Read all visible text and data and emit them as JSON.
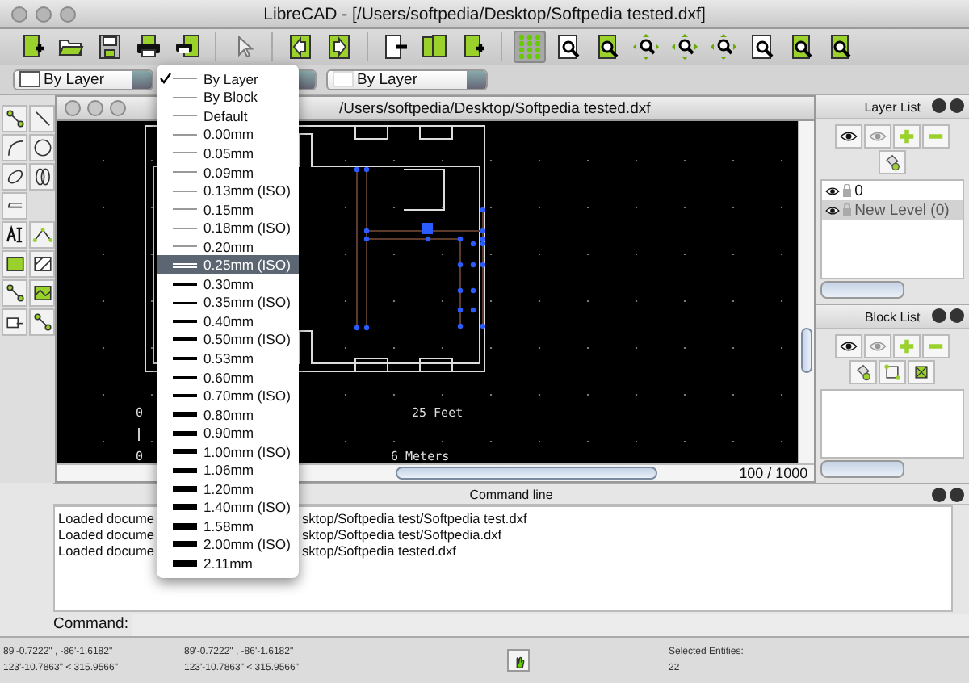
{
  "window": {
    "title": "LibreCAD - [/Users/softpedia/Desktop/Softpedia tested.dxf]"
  },
  "toolbar": {
    "grid_toggle": {
      "on": true
    }
  },
  "pen_toolbar": {
    "color_combo": "By Layer",
    "line_type_combo": "By Layer"
  },
  "line_width_menu": {
    "items": [
      {
        "label": "By Layer",
        "checked": true,
        "selected": false,
        "kind": "hair"
      },
      {
        "label": "By Block",
        "checked": false,
        "selected": false,
        "kind": "hair"
      },
      {
        "label": "Default",
        "checked": false,
        "selected": false,
        "kind": "hair"
      },
      {
        "label": "0.00mm",
        "checked": false,
        "selected": false,
        "kind": "hair"
      },
      {
        "label": "0.05mm",
        "checked": false,
        "selected": false,
        "kind": "hair"
      },
      {
        "label": "0.09mm",
        "checked": false,
        "selected": false,
        "kind": "hair"
      },
      {
        "label": "0.13mm (ISO)",
        "checked": false,
        "selected": false,
        "kind": "hair"
      },
      {
        "label": "0.15mm",
        "checked": false,
        "selected": false,
        "kind": "hair"
      },
      {
        "label": "0.18mm (ISO)",
        "checked": false,
        "selected": false,
        "kind": "hair"
      },
      {
        "label": "0.20mm",
        "checked": false,
        "selected": false,
        "kind": "hair"
      },
      {
        "label": "0.25mm (ISO)",
        "checked": false,
        "selected": true,
        "kind": "double"
      },
      {
        "label": "0.30mm",
        "checked": false,
        "selected": false,
        "kind": "thin"
      },
      {
        "label": "0.35mm (ISO)",
        "checked": false,
        "selected": false,
        "kind": "thin"
      },
      {
        "label": "0.40mm",
        "checked": false,
        "selected": false,
        "kind": "thin"
      },
      {
        "label": "0.50mm (ISO)",
        "checked": false,
        "selected": false,
        "kind": "medium"
      },
      {
        "label": "0.53mm",
        "checked": false,
        "selected": false,
        "kind": "medium"
      },
      {
        "label": "0.60mm",
        "checked": false,
        "selected": false,
        "kind": "medium"
      },
      {
        "label": "0.70mm (ISO)",
        "checked": false,
        "selected": false,
        "kind": "medium"
      },
      {
        "label": "0.80mm",
        "checked": false,
        "selected": false,
        "kind": "thick"
      },
      {
        "label": "0.90mm",
        "checked": false,
        "selected": false,
        "kind": "thick"
      },
      {
        "label": "1.00mm (ISO)",
        "checked": false,
        "selected": false,
        "kind": "thick"
      },
      {
        "label": "1.06mm",
        "checked": false,
        "selected": false,
        "kind": "thick"
      },
      {
        "label": "1.20mm",
        "checked": false,
        "selected": false,
        "kind": "heavy"
      },
      {
        "label": "1.40mm (ISO)",
        "checked": false,
        "selected": false,
        "kind": "heavy"
      },
      {
        "label": "1.58mm",
        "checked": false,
        "selected": false,
        "kind": "heavy"
      },
      {
        "label": "2.00mm (ISO)",
        "checked": false,
        "selected": false,
        "kind": "heavy"
      },
      {
        "label": "2.11mm",
        "checked": false,
        "selected": false,
        "kind": "heavy"
      }
    ]
  },
  "drawing": {
    "title": "/Users/softpedia/Desktop/Softpedia tested.dxf",
    "feet_label": "25 Feet",
    "meters_label": "6 Meters",
    "origin_labels": [
      "0",
      "0"
    ],
    "zoom_readout": "100 / 1000"
  },
  "layer_list": {
    "title": "Layer List",
    "layers": [
      {
        "name": "0",
        "selected": false
      },
      {
        "name": "New Level (0)",
        "selected": true
      }
    ]
  },
  "block_list": {
    "title": "Block List"
  },
  "command_line": {
    "title": "Command line",
    "log": [
      {
        "start": "Loaded docume",
        "end": "sktop/Softpedia test/Softpedia test.dxf"
      },
      {
        "start": "Loaded docume",
        "end": "sktop/Softpedia test/Softpedia.dxf"
      },
      {
        "start": "Loaded docume",
        "end": "sktop/Softpedia tested.dxf"
      }
    ],
    "prompt": "Command:"
  },
  "status_bar": {
    "coords": [
      {
        "line1": "89'-0.7222\" , -86'-1.6182\"",
        "line2": "123'-10.7863\" < 315.9566\""
      },
      {
        "line1": "89'-0.7222\" , -86'-1.6182\"",
        "line2": "123'-10.7863\" < 315.9566\""
      }
    ],
    "selected_label": "Selected Entities:",
    "selected_count": "22"
  }
}
